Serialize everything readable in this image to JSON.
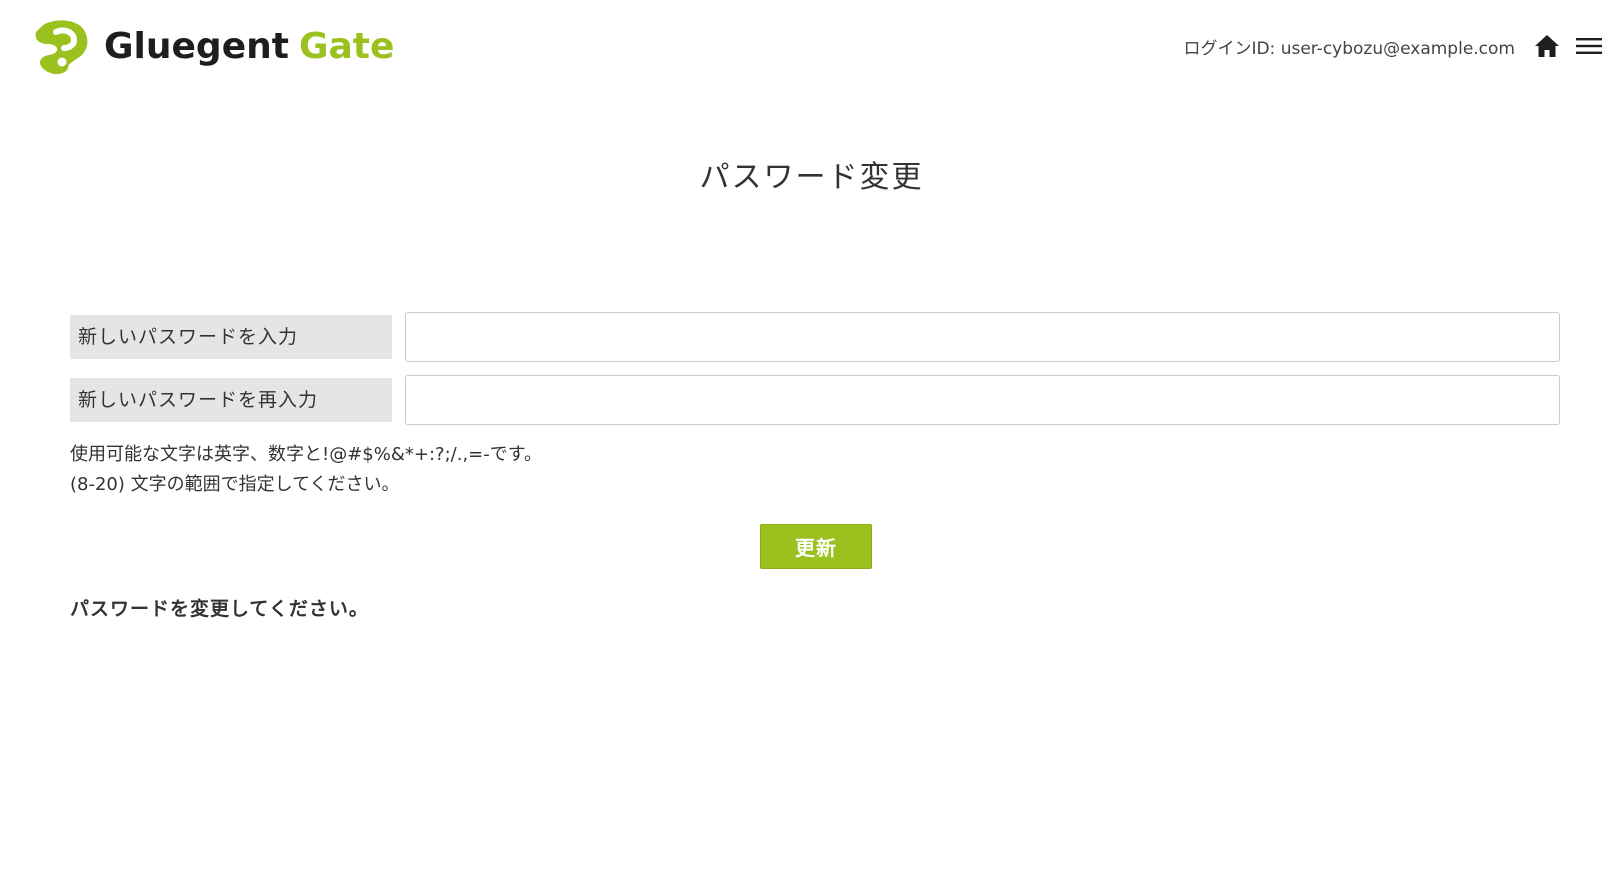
{
  "header": {
    "logo": {
      "word1": "Gluegent",
      "word2": "Gate",
      "icon": "gluegent-logo-icon",
      "brand_color": "#9bc11f"
    },
    "login_id": "ログインID: user-cybozu@example.com",
    "home_icon": "home-icon",
    "menu_icon": "hamburger-menu-icon"
  },
  "page": {
    "title": "パスワード変更"
  },
  "form": {
    "new_password_label": "新しいパスワードを入力",
    "new_password_value": "",
    "confirm_password_label": "新しいパスワードを再入力",
    "confirm_password_value": "",
    "help_line1": "使用可能な文字は英字、数字と!@#$%&*+:?;/.,=-です。",
    "help_line2": "(8-20) 文字の範囲で指定してください。",
    "submit_label": "更新"
  },
  "message": "パスワードを変更してください。"
}
